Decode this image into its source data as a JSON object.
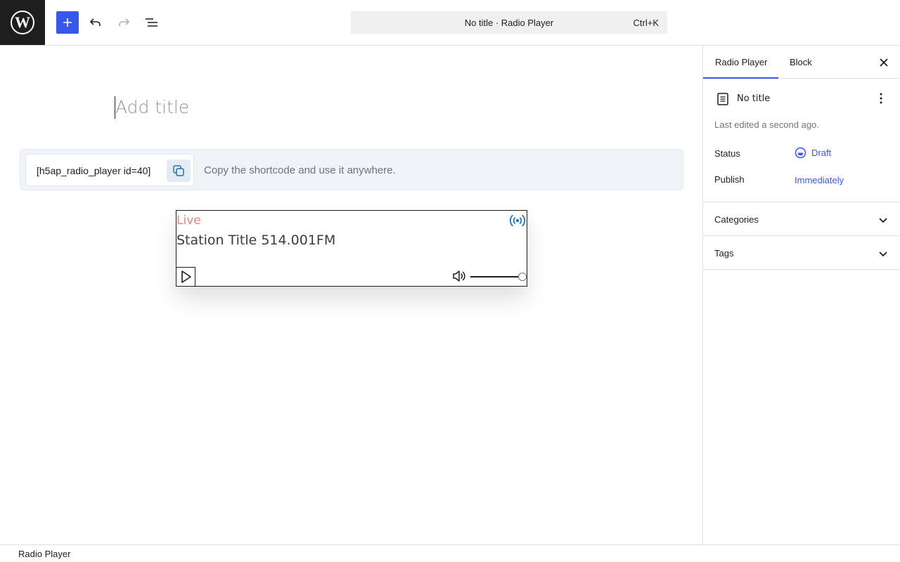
{
  "toolbar": {
    "logo_icon": "wordpress-logo-icon",
    "add_icon": "plus-icon",
    "undo_icon": "undo-icon",
    "redo_icon": "redo-icon",
    "list_icon": "document-overview-icon",
    "command_title": "No title · Radio Player",
    "command_shortcut": "Ctrl+K",
    "accent_color": "#3858e9"
  },
  "editor": {
    "title_placeholder": "Add title",
    "shortcode": "[h5ap_radio_player id=40]",
    "shortcode_help": "Copy the shortcode and use it anywhere.",
    "copy_icon": "copy-icon"
  },
  "player": {
    "live_label": "Live",
    "station_title": "Station Title 514.001FM",
    "broadcast_icon": "broadcast-icon",
    "play_icon": "play-icon",
    "volume_icon": "volume-icon",
    "volume_level": 1.0,
    "live_color": "#f08080",
    "broadcast_color": "#1e73be"
  },
  "sidebar": {
    "tabs": [
      {
        "label": "Radio Player",
        "active": true
      },
      {
        "label": "Block",
        "active": false
      }
    ],
    "close_icon": "close-icon",
    "post_title": "No title",
    "post_icon": "page-icon",
    "more_icon": "more-vertical-icon",
    "last_edited": "Last edited a second ago.",
    "status_label": "Status",
    "status_value": "Draft",
    "status_icon": "draft-circle-icon",
    "publish_label": "Publish",
    "publish_value": "Immediately",
    "panels": [
      {
        "label": "Categories",
        "icon": "chevron-down-icon"
      },
      {
        "label": "Tags",
        "icon": "chevron-down-icon"
      }
    ]
  },
  "footer": {
    "breadcrumb": "Radio Player"
  }
}
